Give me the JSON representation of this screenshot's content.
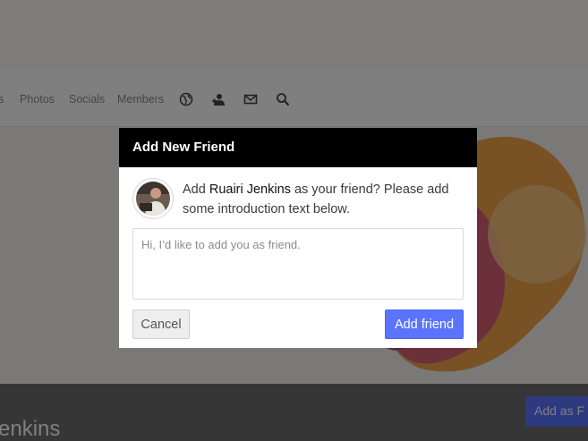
{
  "nav": {
    "items": [
      {
        "label": "s"
      },
      {
        "label": "Photos"
      },
      {
        "label": "Socials"
      },
      {
        "label": "Members"
      }
    ]
  },
  "profile": {
    "name_fragment": "enkins",
    "add_button_label": "Add as F"
  },
  "modal": {
    "title": "Add New Friend",
    "message_prefix": "Add ",
    "friend_name": "Ruairi Jenkins",
    "message_suffix": " as your friend? Please add some introduction text below.",
    "intro_placeholder": "Hi, I’d like to add you as friend.",
    "cancel_label": "Cancel",
    "add_label": "Add friend"
  },
  "colors": {
    "accent": "#5b74ff",
    "header_bg": "#000000"
  },
  "icons": {
    "nav": [
      "globe-icon",
      "friends-icon",
      "mail-icon",
      "search-icon"
    ]
  }
}
